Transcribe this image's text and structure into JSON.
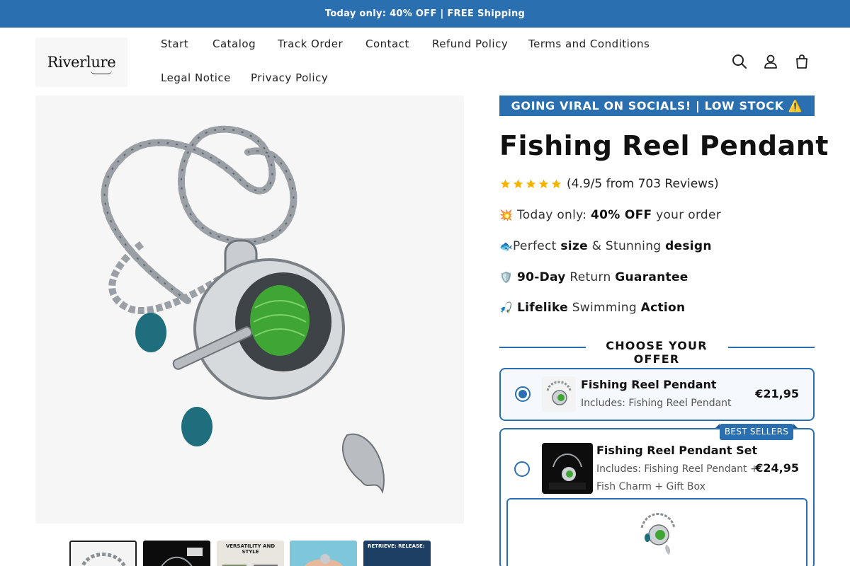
{
  "announcement": "Today only: 40% OFF | FREE Shipping",
  "brand": {
    "logo_text": "Riverlure"
  },
  "nav": {
    "items": [
      "Start",
      "Catalog",
      "Track Order",
      "Contact",
      "Refund Policy",
      "Terms and Conditions",
      "Legal Notice",
      "Privacy Policy"
    ]
  },
  "header_icons": [
    "search-icon",
    "account-icon",
    "cart-icon"
  ],
  "gallery": {
    "main_image": "fishing-reel-pendant-photo",
    "thumbnails": [
      {
        "name": "thumb-pendant-chain",
        "label": ""
      },
      {
        "name": "thumb-gift-box",
        "label": ""
      },
      {
        "name": "thumb-versatility",
        "label": "VERSATILITY AND STYLE"
      },
      {
        "name": "thumb-hand",
        "label": ""
      },
      {
        "name": "thumb-retrieve-release",
        "label": "RETRIEVE: RELEASE:"
      }
    ]
  },
  "product": {
    "viral_banner": "GOING VIRAL ON SOCIALS! | LOW STOCK ⚠️",
    "title": "Fishing Reel Pendant",
    "rating_text": "(4.9/5 from 703 Reviews)",
    "rating_value": 4.9,
    "stars": 5
  },
  "bullets": [
    {
      "emoji": "💥",
      "parts": [
        "Today only: ",
        "40% OFF",
        " your order"
      ]
    },
    {
      "emoji": "🐟",
      "parts": [
        "Perfect ",
        "size",
        " & Stunning ",
        "design"
      ]
    },
    {
      "emoji": "🛡️",
      "parts": [
        "",
        "90-Day",
        " Return ",
        "Guarantee"
      ]
    },
    {
      "emoji": "🎣",
      "parts": [
        "",
        "Lifelike",
        " Swimming ",
        "Action"
      ]
    }
  ],
  "offer": {
    "heading": "CHOOSE YOUR OFFER",
    "options": [
      {
        "name": "Fishing Reel Pendant",
        "includes": "Includes: Fishing Reel Pendant",
        "price": "€21,95",
        "selected": true
      },
      {
        "name": "Fishing Reel Pendant Set",
        "includes": "Includes: Fishing Reel Pendant + Fish Charm + Gift Box",
        "price": "€24,95",
        "selected": false,
        "badge": "BEST SELLERS"
      }
    ]
  },
  "colors": {
    "accent": "#2a6fb0",
    "text": "#111111",
    "background": "#ffffff"
  }
}
